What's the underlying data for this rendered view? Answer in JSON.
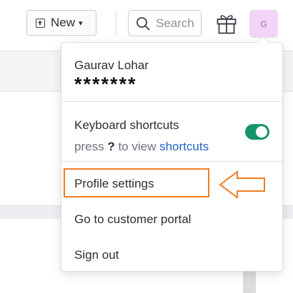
{
  "toolbar": {
    "new_label": "New",
    "search_placeholder": "Search",
    "avatar_initial": "G"
  },
  "menu": {
    "user_name": "Gaurav Lohar",
    "user_email_masked": "*******",
    "keyboard_shortcuts": {
      "title": "Keyboard shortcuts",
      "hint_prefix": "press",
      "hint_key": "?",
      "hint_middle": "to view",
      "hint_link": "shortcuts",
      "enabled": true
    },
    "items": [
      {
        "label": "Profile settings"
      },
      {
        "label": "Go to customer portal"
      },
      {
        "label": "Sign out"
      }
    ]
  },
  "colors": {
    "toggle_on": "#16946c",
    "highlight": "#ee7d24",
    "link": "#2563c9",
    "avatar_bg": "#f2d4f6"
  },
  "icons": [
    "plus-square-icon",
    "chevron-down-icon",
    "search-icon",
    "gift-icon",
    "arrow-left-icon"
  ]
}
